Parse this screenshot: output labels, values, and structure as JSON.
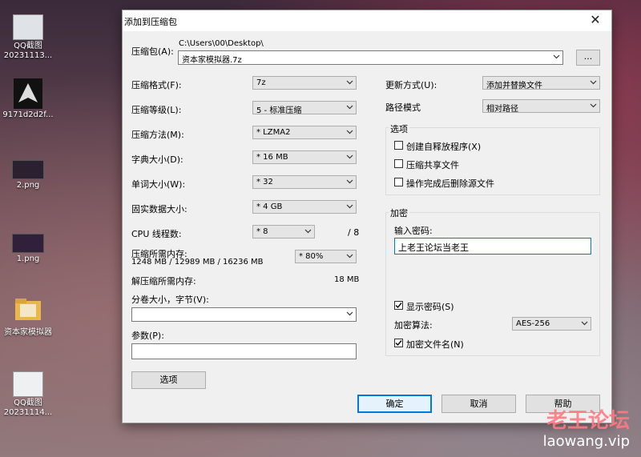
{
  "desktop": {
    "icons": [
      {
        "label": "QQ截图\n20231113...",
        "icon": "screenshot-icon"
      },
      {
        "label": "9171d2d2f...",
        "icon": "emblem-icon"
      },
      {
        "label": "2.png",
        "icon": "image-icon"
      },
      {
        "label": "1.png",
        "icon": "image-icon"
      },
      {
        "label": "资本家模拟器",
        "icon": "folder-icon"
      },
      {
        "label": "QQ截图\n20231114...",
        "icon": "screenshot-icon"
      }
    ]
  },
  "dialog": {
    "title": "添加到压缩包",
    "archive": {
      "label": "压缩包(A):",
      "path": "C:\\Users\\00\\Desktop\\",
      "filename": "资本家模拟器.7z",
      "browse_label": "..."
    },
    "format": {
      "label": "压缩格式(F):",
      "value": "7z"
    },
    "level": {
      "label": "压缩等级(L):",
      "value": "5 - 标准压缩"
    },
    "method": {
      "label": "压缩方法(M):",
      "value": "* LZMA2"
    },
    "dict": {
      "label": "字典大小(D):",
      "value": "* 16 MB"
    },
    "word": {
      "label": "单词大小(W):",
      "value": "* 32"
    },
    "solid": {
      "label": "固实数据大小:",
      "value": "* 4 GB"
    },
    "threads": {
      "label": "CPU 线程数:",
      "value": "* 8",
      "max": "/ 8"
    },
    "mem_compress": {
      "label": "压缩所需内存:",
      "detail": "1248 MB / 12989 MB / 16236 MB",
      "value": "* 80%"
    },
    "mem_decompress": {
      "label": "解压缩所需内存:",
      "value": "18 MB"
    },
    "split": {
      "label": "分卷大小，字节(V):",
      "value": ""
    },
    "params": {
      "label": "参数(P):",
      "value": ""
    },
    "options_button": "选项",
    "update_mode": {
      "label": "更新方式(U):",
      "value": "添加并替换文件"
    },
    "path_mode": {
      "label": "路径模式",
      "value": "相对路径"
    },
    "options_group": {
      "title": "选项",
      "items": [
        {
          "label": "创建自释放程序(X)",
          "checked": false
        },
        {
          "label": "压缩共享文件",
          "checked": false
        },
        {
          "label": "操作完成后删除源文件",
          "checked": false
        }
      ]
    },
    "encryption": {
      "title": "加密",
      "password_label": "输入密码:",
      "password_value": "上老王论坛当老王",
      "show_password": {
        "label": "显示密码(S)",
        "checked": true
      },
      "method_label": "加密算法:",
      "method_value": "AES-256",
      "encrypt_names": {
        "label": "加密文件名(N)",
        "checked": true
      }
    },
    "buttons": {
      "ok": "确定",
      "cancel": "取消",
      "help": "帮助"
    }
  },
  "watermark": {
    "cn": "老王论坛",
    "url": "laowang.vip"
  }
}
